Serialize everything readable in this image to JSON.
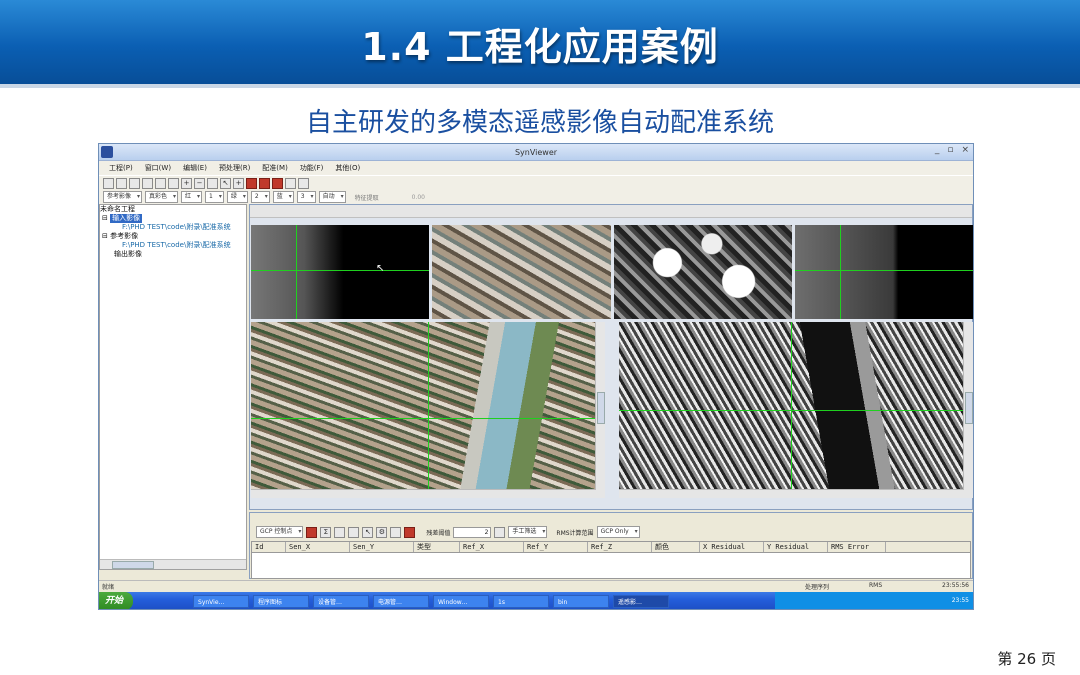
{
  "slide": {
    "title": "1.4  工程化应用案例",
    "subtitle": "自主研发的多模态遥感影像自动配准系统",
    "page_number": "第 26 页"
  },
  "window": {
    "title": "SynViewer",
    "controls": [
      "_",
      "▫",
      "×"
    ]
  },
  "menu": [
    "工程(P)",
    "窗口(W)",
    "编辑(E)",
    "预处理(R)",
    "配准(M)",
    "功能(F)",
    "其他(O)"
  ],
  "toolbar2": {
    "reference": "参考影像",
    "color_mode": "真彩色",
    "band_r_label": "红",
    "band_r": "1",
    "band_g_label": "绿",
    "band_g": "2",
    "band_b_label": "蓝",
    "band_b": "3",
    "stretch": "自动",
    "feature_label": "特征提取",
    "progress": "0.00"
  },
  "tree": {
    "root": "未命名工程",
    "input_group": "输入影像",
    "input_path": "F:\\PHD TEST\\code\\附录\\配准系统",
    "ref_group": "参考影像",
    "ref_path": "F:\\PHD TEST\\code\\附录\\配准系统",
    "output_group": "输出影像"
  },
  "gcp": {
    "mode_label": "GCP 控制点",
    "threshold_label": "残差阈值",
    "threshold_value": "2",
    "manual_label": "手工筛选",
    "rms_label": "RMS计算范围",
    "rms_scope": "GCP Only",
    "columns": [
      "Id",
      "Sen_X",
      "Sen_Y",
      "类型",
      "Ref_X",
      "Ref_Y",
      "Ref_Z",
      "颜色",
      "X Residual",
      "Y Residual",
      "RMS Error"
    ]
  },
  "status": {
    "left": "就绪",
    "right1": "处理序列",
    "right2": "RMS",
    "time": "23:55:56"
  },
  "taskbar": {
    "start": "开始",
    "tasks": [
      "SynVie…",
      "程序图标",
      "设备管…",
      "电源管…",
      "Window…",
      "1s",
      "bin",
      "遥感影…"
    ],
    "clock": "23:55"
  }
}
